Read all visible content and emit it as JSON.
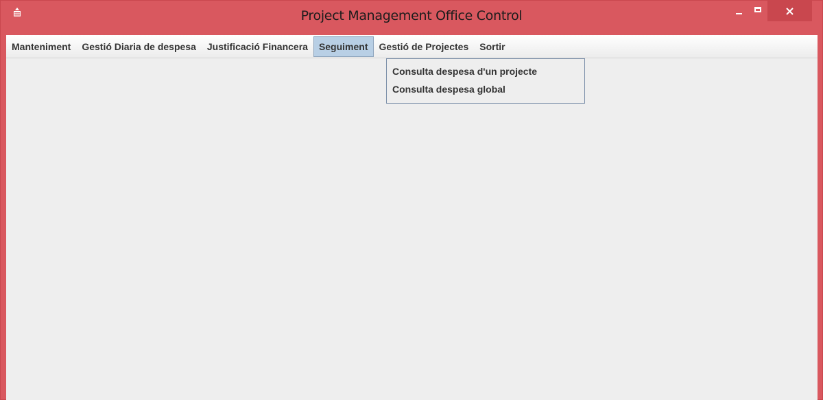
{
  "window": {
    "title": "Project Management Office Control",
    "controls": {
      "minimize": "minimize-icon",
      "maximize": "maximize-icon",
      "close": "close-icon"
    },
    "colors": {
      "frame": "#d9585f",
      "close_button": "#c9474e",
      "client": "#eeeeee"
    }
  },
  "menubar": {
    "items": [
      {
        "label": "Manteniment"
      },
      {
        "label": "Gestió Diaria de despesa"
      },
      {
        "label": "Justificació Financera"
      },
      {
        "label": "Seguiment",
        "active": true
      },
      {
        "label": "Gestió de Projectes"
      },
      {
        "label": "Sortir"
      }
    ]
  },
  "dropdown": {
    "items": [
      {
        "label": "Consulta despesa d'un projecte"
      },
      {
        "label": "Consulta despesa global"
      }
    ]
  }
}
